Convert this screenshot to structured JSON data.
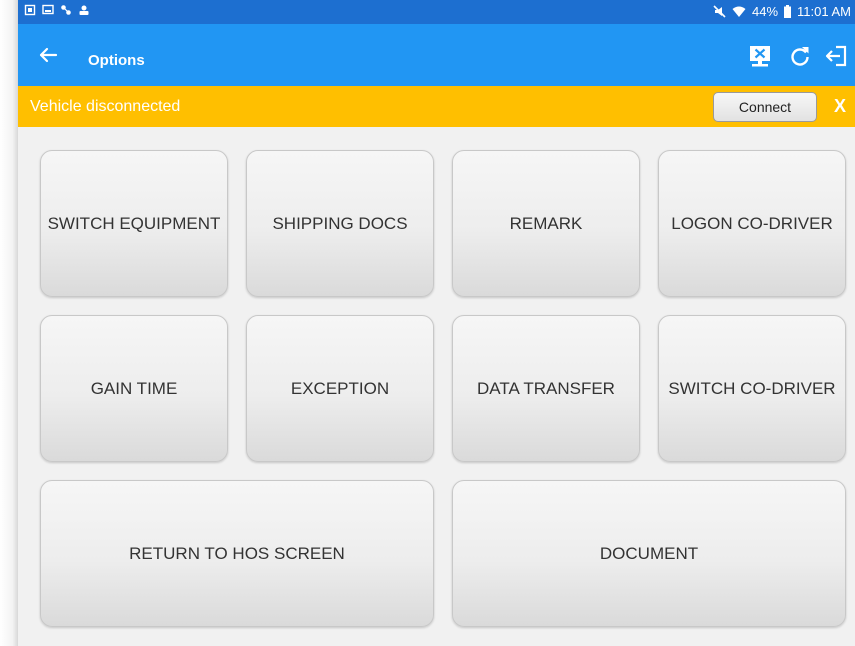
{
  "status_bar": {
    "battery": "44%",
    "time": "11:01 AM"
  },
  "app_bar": {
    "title": "Options",
    "icons": [
      "back-arrow-icon",
      "disconnect-device-icon",
      "refresh-icon",
      "logout-icon"
    ]
  },
  "banner": {
    "message": "Vehicle disconnected",
    "connect_label": "Connect",
    "close_label": "X"
  },
  "options": [
    {
      "label": "SWITCH EQUIPMENT"
    },
    {
      "label": "SHIPPING DOCS"
    },
    {
      "label": "REMARK"
    },
    {
      "label": "LOGON CO-DRIVER"
    },
    {
      "label": "GAIN TIME"
    },
    {
      "label": "EXCEPTION"
    },
    {
      "label": "DATA TRANSFER"
    },
    {
      "label": "SWITCH CO-DRIVER"
    },
    {
      "label": "RETURN TO HOS SCREEN"
    },
    {
      "label": "DOCUMENT"
    }
  ],
  "colors": {
    "status_bar": "#1d6fd0",
    "app_bar": "#2196f3",
    "banner": "#ffbf00",
    "background": "#f1f1f1"
  }
}
